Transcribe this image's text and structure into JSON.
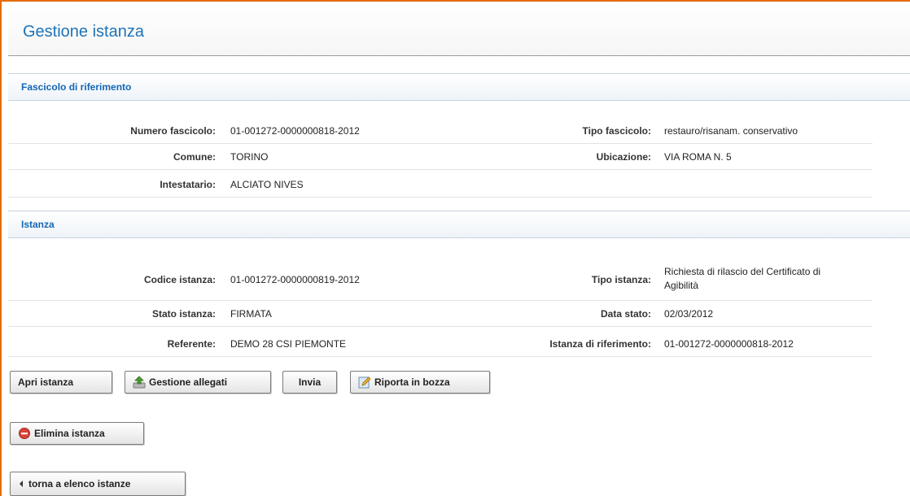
{
  "header": {
    "title": "Gestione istanza"
  },
  "fascicolo": {
    "section_title": "Fascicolo di riferimento",
    "numero_label": "Numero fascicolo:",
    "numero_value": "01-001272-0000000818-2012",
    "tipo_label": "Tipo fascicolo:",
    "tipo_value": "restauro/risanam. conservativo",
    "comune_label": "Comune:",
    "comune_value": "TORINO",
    "ubicazione_label": "Ubicazione:",
    "ubicazione_value": "VIA ROMA N. 5",
    "intestatario_label": "Intestatario:",
    "intestatario_value": "ALCIATO NIVES"
  },
  "istanza": {
    "section_title": "Istanza",
    "codice_label": "Codice istanza:",
    "codice_value": "01-001272-0000000819-2012",
    "tipo_label": "Tipo istanza:",
    "tipo_value_line1": "Richiesta di rilascio del Certificato di",
    "tipo_value_line2": "Agibilità",
    "stato_label": "Stato istanza:",
    "stato_value": "FIRMATA",
    "data_label": "Data stato:",
    "data_value": "02/03/2012",
    "referente_label": "Referente:",
    "referente_value": "DEMO 28 CSI PIEMONTE",
    "rif_label": "Istanza di riferimento:",
    "rif_value": "01-001272-0000000818-2012"
  },
  "actions": {
    "apri": "Apri istanza",
    "allegati": "Gestione allegati",
    "invia": "Invia",
    "bozza": "Riporta in bozza",
    "elimina": "Elimina istanza",
    "torna": "torna a elenco istanze"
  },
  "icons": {
    "allegati": "attachment-upload-icon",
    "bozza": "edit-pencil-icon",
    "elimina": "delete-minus-icon",
    "torna": "back-arrow-icon"
  },
  "colors": {
    "accent": "#e46c0a",
    "title": "#1e73b8",
    "section_title": "#1565b5",
    "delete": "#d9433b"
  }
}
